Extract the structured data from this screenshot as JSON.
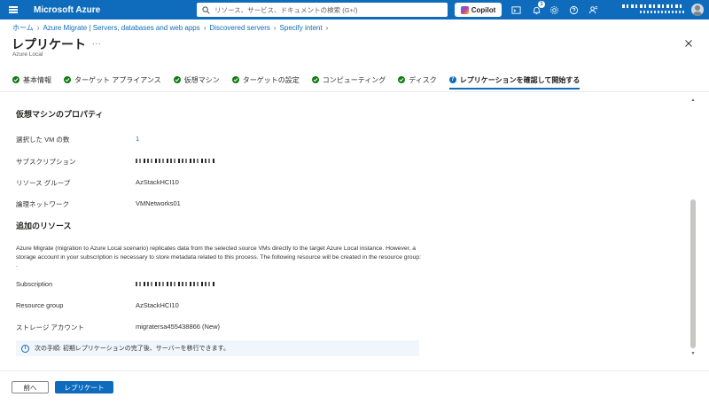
{
  "topbar": {
    "brand": "Microsoft Azure",
    "search_placeholder": "リソース、サービス、ドキュメントの検索 (G+/)",
    "copilot_label": "Copilot",
    "notification_count": "1",
    "accent_color": "#0f6cbd"
  },
  "breadcrumb": {
    "items": [
      "ホーム",
      "Azure Migrate | Servers, databases and web apps",
      "Discovered servers",
      "Specify intent"
    ]
  },
  "header": {
    "title": "レプリケート",
    "more": "...",
    "subtitle": "Azure Local"
  },
  "tabs": [
    {
      "label": "基本情報",
      "state": "done"
    },
    {
      "label": "ターゲット アプライアンス",
      "state": "done"
    },
    {
      "label": "仮想マシン",
      "state": "done"
    },
    {
      "label": "ターゲットの設定",
      "state": "done"
    },
    {
      "label": "コンピューティング",
      "state": "done"
    },
    {
      "label": "ディスク",
      "state": "done"
    },
    {
      "label": "レプリケーションを確認して開始する",
      "state": "active",
      "step": "7"
    }
  ],
  "vm_properties": {
    "heading": "仮想マシンのプロパティ",
    "selected_vm_label": "選択した VM の数",
    "selected_vm_value": "1",
    "subscription_label": "サブスクリプション",
    "resource_group_label": "リソース グループ",
    "resource_group_value": "AzStackHCI10",
    "logical_network_label": "論理ネットワーク",
    "logical_network_value": "VMNetworks01"
  },
  "additional_resources": {
    "heading": "追加のリソース",
    "description": "Azure Migrate (migration to Azure Local scenario) replicates data from the selected source VMs directly to the target Azure Local instance. However, a storage account in your subscription is necessary to store metadata related to this process. The following resource will be created in the resource group: .",
    "subscription_label": "Subscription",
    "resource_group_label": "Resource group",
    "resource_group_value": "AzStackHCI10",
    "storage_label": "ストレージ アカウント",
    "storage_value": "migratersa455438866 (New)"
  },
  "info": {
    "text": "次の手順: 初期レプリケーションの完了後、サーバーを移行できます。"
  },
  "footer": {
    "prev_label": "前へ",
    "replicate_label": "レプリケート"
  }
}
